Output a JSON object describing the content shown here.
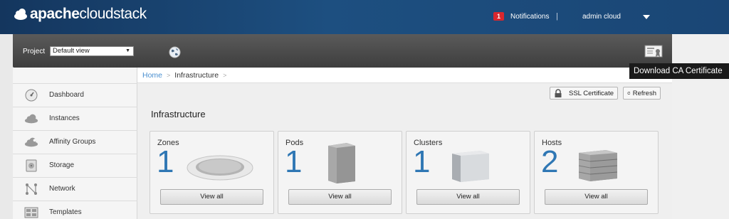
{
  "header": {
    "logo_text_bold": "apache",
    "logo_text_rest": "cloudstack",
    "notifications_count": "1",
    "notifications_label": "Notifications",
    "separator": "|",
    "user": "admin cloud"
  },
  "project_bar": {
    "label": "Project",
    "selected": "Default view"
  },
  "tooltip": "Download CA Certificate",
  "sidebar": {
    "items": [
      {
        "label": "Dashboard",
        "icon": "dashboard-icon"
      },
      {
        "label": "Instances",
        "icon": "cloud-icon"
      },
      {
        "label": "Affinity Groups",
        "icon": "affinity-icon"
      },
      {
        "label": "Storage",
        "icon": "storage-icon"
      },
      {
        "label": "Network",
        "icon": "network-icon"
      },
      {
        "label": "Templates",
        "icon": "templates-icon"
      }
    ]
  },
  "breadcrumb": {
    "home": "Home",
    "current": "Infrastructure",
    "arrow": ">"
  },
  "toolbar": {
    "ssl_label": "SSL Certificate",
    "refresh_label": "Refresh"
  },
  "main": {
    "title": "Infrastructure",
    "cards": [
      {
        "label": "Zones",
        "count": "1",
        "button": "View all"
      },
      {
        "label": "Pods",
        "count": "1",
        "button": "View all"
      },
      {
        "label": "Clusters",
        "count": "1",
        "button": "View all"
      },
      {
        "label": "Hosts",
        "count": "2",
        "button": "View all"
      }
    ]
  }
}
